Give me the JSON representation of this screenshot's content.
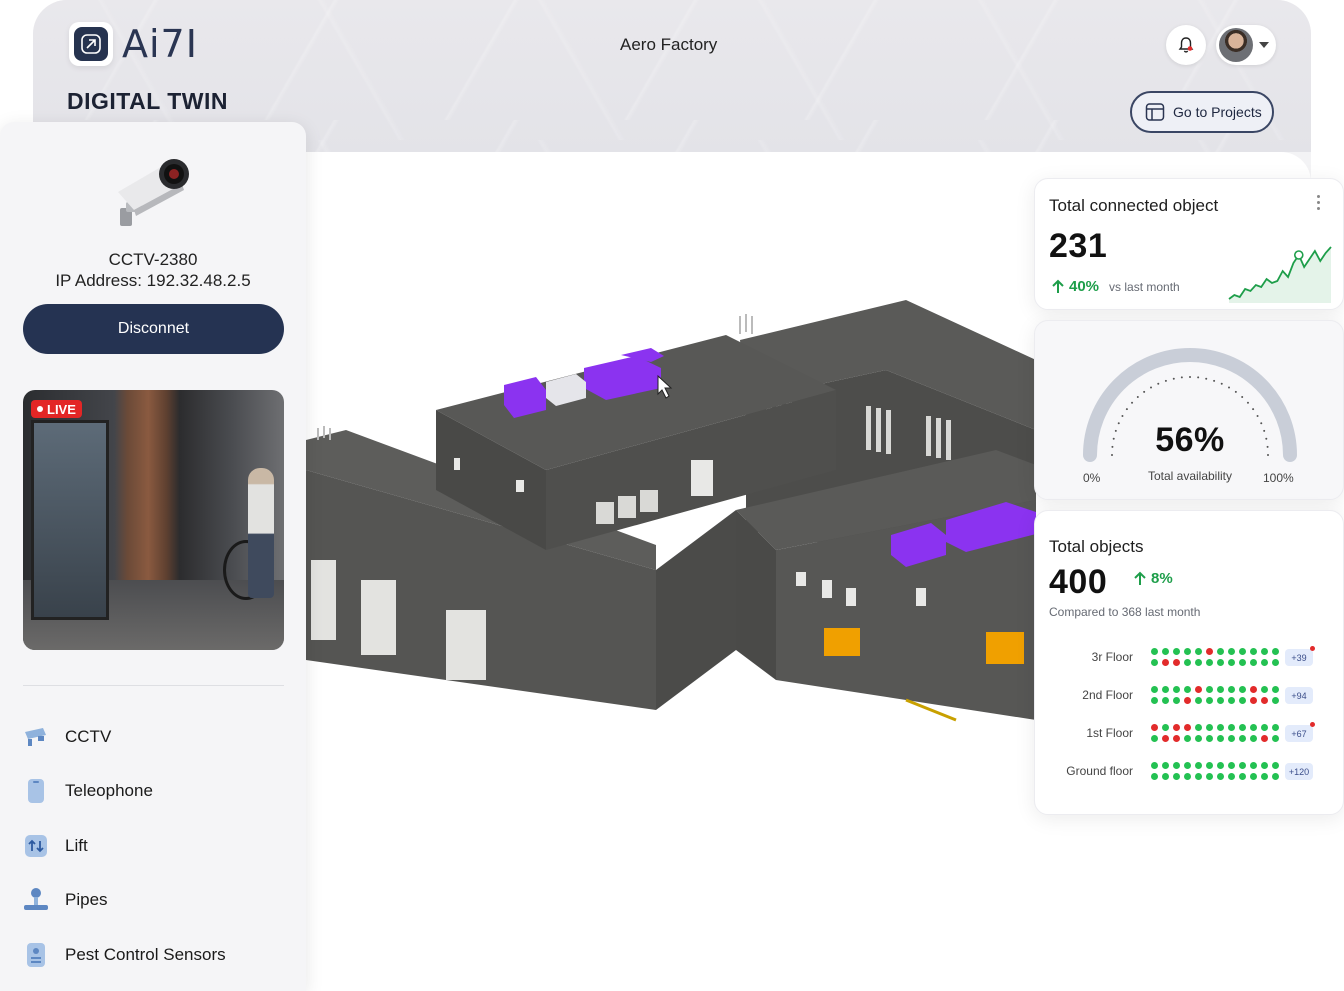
{
  "header": {
    "brand": "Ai7I",
    "app_title": "DIGITAL TWIN",
    "site_name": "Aero Factory",
    "go_to_projects": "Go to Projects"
  },
  "device": {
    "name": "CCTV-2380",
    "ip": "IP Address: 192.32.48.2.5",
    "disconnect_label": "Disconnet",
    "live_label": "LIVE"
  },
  "sidebar": {
    "items": [
      {
        "label": "CCTV",
        "icon": "cctv-icon"
      },
      {
        "label": "Teleophone",
        "icon": "telephone-icon"
      },
      {
        "label": "Lift",
        "icon": "lift-icon"
      },
      {
        "label": "Pipes",
        "icon": "pipes-icon"
      },
      {
        "label": "Pest Control Sensors",
        "icon": "sensor-icon"
      }
    ]
  },
  "connected": {
    "title": "Total connected object",
    "value": "231",
    "change": "40%",
    "change_note": "vs last month",
    "sparkline": [
      4,
      6,
      5,
      9,
      8,
      11,
      10,
      14,
      12,
      13,
      18,
      15,
      22,
      26,
      20,
      24,
      28,
      23,
      27,
      30
    ]
  },
  "availability": {
    "value": "56%",
    "label": "Total availability",
    "min_label": "0%",
    "max_label": "100%",
    "fraction": 0.56
  },
  "objects": {
    "title": "Total objects",
    "value": "400",
    "change": "8%",
    "compare": "Compared to 368 last month",
    "floors": [
      {
        "label": "3r Floor",
        "badge": "+39",
        "alert": true,
        "top": "gggggrgggggg",
        "bottom": "grrgggggggg g"
      },
      {
        "label": "2nd Floor",
        "badge": "+94",
        "alert": false,
        "top": "ggggrggggrgg",
        "bottom": "gggrgggggrrg"
      },
      {
        "label": "1st Floor",
        "badge": "+67",
        "alert": true,
        "top": "rgrrgggggggg",
        "bottom": "grrgggggggr "
      },
      {
        "label": "Ground floor",
        "badge": "+120",
        "alert": false,
        "top": "gggggggggggg",
        "bottom": "gggggggggggg"
      }
    ]
  },
  "colors": {
    "primary": "#253352",
    "green": "#1e9e4a",
    "red": "#e22b2b",
    "live": "#e32626",
    "building_accent": "#8b33f0"
  }
}
